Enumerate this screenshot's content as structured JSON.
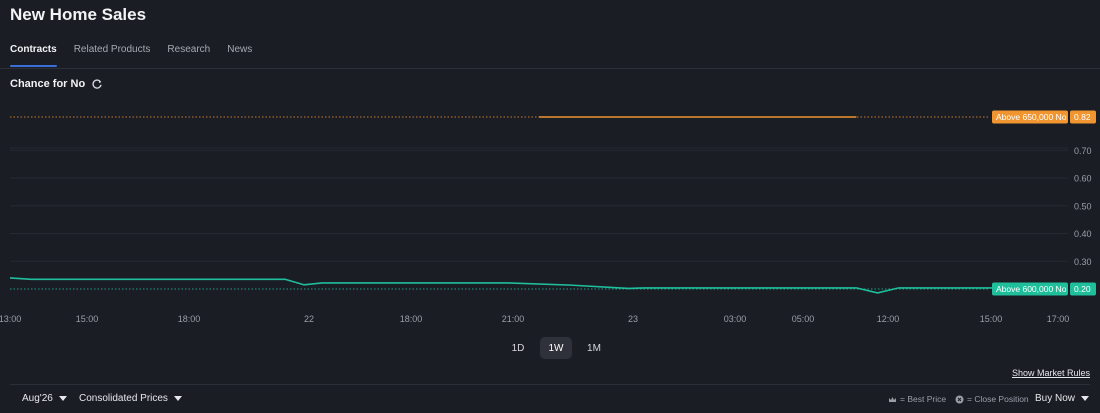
{
  "page": {
    "title": "New Home Sales"
  },
  "tabs": [
    {
      "label": "Contracts",
      "active": true
    },
    {
      "label": "Related Products",
      "active": false
    },
    {
      "label": "Research",
      "active": false
    },
    {
      "label": "News",
      "active": false
    }
  ],
  "chart_header": {
    "label": "Chance for No",
    "icon": "refresh-icon"
  },
  "chart_data": {
    "type": "line",
    "title": "Chance for No",
    "y_ticks": [
      "0.30",
      "0.40",
      "0.50",
      "0.60",
      "0.70"
    ],
    "x_ticks": [
      "13:00",
      "15:00",
      "18:00",
      "22",
      "18:00",
      "21:00",
      "23",
      "03:00",
      "05:00",
      "12:00",
      "15:00",
      "17:00"
    ],
    "ylim": [
      0.2,
      0.82
    ],
    "grid": true,
    "series": [
      {
        "name": "Above 650,000 No",
        "color": "#f0952f",
        "current_label": "0.82",
        "baseline": 0.82,
        "x": [
          0.5,
          0.8
        ],
        "y": [
          0.82,
          0.82
        ]
      },
      {
        "name": "Above 600,000 No",
        "color": "#1fbf9c",
        "current_label": "0.20",
        "baseline": 0.2,
        "x": [
          0.0,
          0.02,
          0.26,
          0.278,
          0.295,
          0.47,
          0.53,
          0.585,
          0.6,
          0.8,
          0.82,
          0.84,
          1.0
        ],
        "y": [
          0.24,
          0.235,
          0.235,
          0.215,
          0.222,
          0.222,
          0.214,
          0.202,
          0.204,
          0.204,
          0.186,
          0.204,
          0.204
        ]
      }
    ]
  },
  "range_buttons": [
    {
      "label": "1D",
      "active": false
    },
    {
      "label": "1W",
      "active": true
    },
    {
      "label": "1M",
      "active": false
    }
  ],
  "market_rules_link": "Show Market Rules",
  "bottom_bar": {
    "contract_month": "Aug'26",
    "price_mode": "Consolidated Prices",
    "legend_best_price": "= Best Price",
    "legend_close_position": "= Close Position",
    "buy_now": "Buy Now"
  }
}
